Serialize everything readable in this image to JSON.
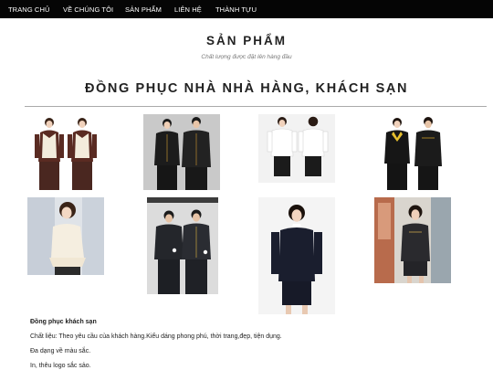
{
  "nav": {
    "items": [
      {
        "label": "TRANG CHỦ"
      },
      {
        "label": "VỀ CHÚNG TÔI"
      },
      {
        "label": "SẢN PHẨM"
      },
      {
        "label": "LIÊN HỆ"
      },
      {
        "label": "THÀNH TỰU"
      }
    ]
  },
  "section": {
    "title": "SẢN PHẨM",
    "subtitle": "Chất lượng được đặt lên hàng đầu"
  },
  "category": {
    "title": "ĐỒNG PHỤC NHÀ NHÀ HÀNG, KHÁCH SẠN"
  },
  "products": [
    {
      "image": "two-women-cream-vests-photo"
    },
    {
      "image": "man-woman-black-uniforms-photo"
    },
    {
      "image": "woman-white-shirt-two-views-photo"
    },
    {
      "image": "couple-black-suits-yellow-scarf-photo"
    },
    {
      "image": "woman-cream-peplum-top-photo"
    },
    {
      "image": "two-men-doorman-uniforms-photo"
    },
    {
      "image": "woman-navy-suit-photo"
    },
    {
      "image": "woman-dark-suit-office-photo"
    }
  ],
  "description": {
    "heading": "Đồng phục khách sạn",
    "lines": [
      "Chất liệu: Theo yêu cầu của khách hàng.Kiểu dáng phong phú, thời trang,đẹp, tiện dụng.",
      "Đa dạng về màu sắc.",
      "In, thêu logo sắc sảo."
    ]
  },
  "colors": {
    "nav_background": "#050505",
    "nav_text": "#ffffff",
    "text": "#222222",
    "rule": "#aaaaaa"
  }
}
